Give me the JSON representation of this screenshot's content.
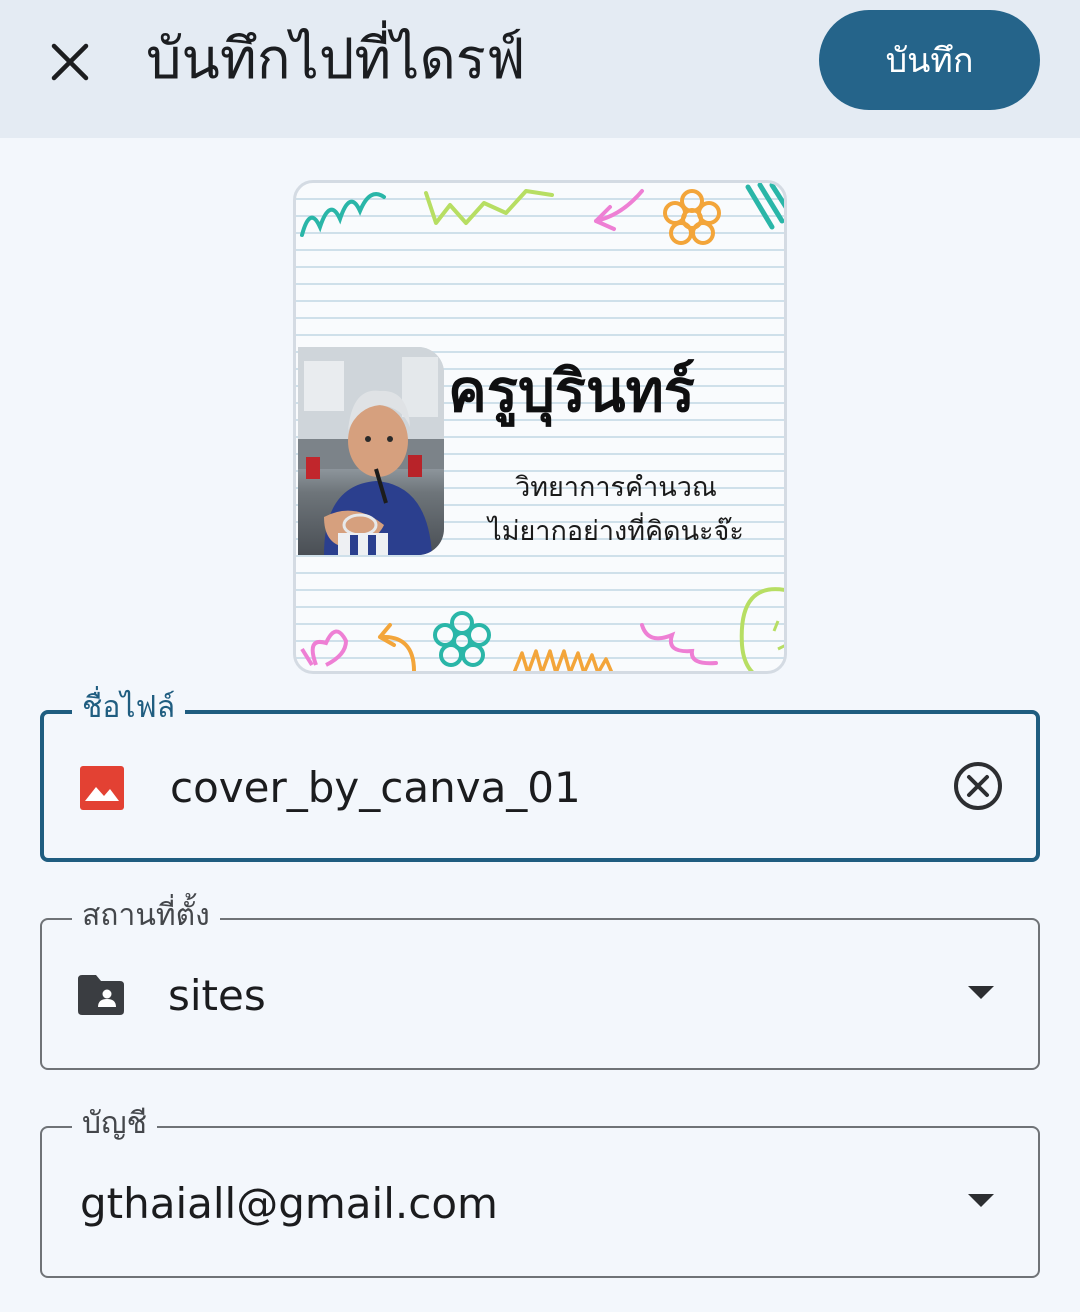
{
  "header": {
    "close_icon": "close-icon",
    "title": "บันทึกไปที่ไดรฟ์",
    "save_label": "บันทึก",
    "accent_color": "#25648a",
    "bar_color": "#e4ebf3"
  },
  "preview": {
    "heading": "ครูบุรินทร์",
    "line1": "วิทยาการคำนวณ",
    "line2": "ไม่ยากอย่างที่คิดนะจ๊ะ"
  },
  "form": {
    "filename": {
      "label": "ชื่อไฟล์",
      "value": "cover_by_canva_01",
      "icon": "image-icon",
      "icon_color": "#e34133",
      "clear_icon": "clear-icon"
    },
    "location": {
      "label": "สถานที่ตั้ง",
      "value": "sites",
      "icon": "shared-folder-icon"
    },
    "account": {
      "label": "บัญชี",
      "value": "gthaiall@gmail.com"
    }
  }
}
